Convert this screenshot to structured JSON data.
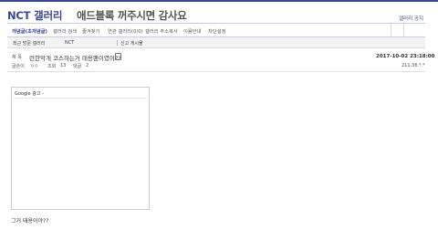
{
  "header": {
    "gallery_name": "NCT 갤러리",
    "subtitle": "애드블록 꺼주시면 감사요",
    "notice_link": "갤러리 공지"
  },
  "menu": {
    "items": [
      {
        "label": "개념글(초개념글)",
        "active": true
      },
      {
        "label": "갤러리 검색"
      },
      {
        "label": "즐겨찾기"
      },
      {
        "label": "연관 갤러리(0/0)"
      },
      {
        "label": "갤러리 주소복사"
      },
      {
        "label": "이용안내"
      },
      {
        "label": "차단설정"
      }
    ]
  },
  "info_bar": {
    "recent_label": "최근 방문 갤러리",
    "recent_gallery": "NCT",
    "new_posts": "신고 게시물"
  },
  "post": {
    "title_label": "제 목",
    "title": "런한악개 코스하는거 태용팬이였어??",
    "date": "2017-10-02 23:18:00",
    "author_label": "글쓴이",
    "author": "ㅇㅇ",
    "views_label": "조회",
    "views": "13",
    "comments_label": "댓글",
    "comments": "2",
    "ip": "211.36.*.*",
    "body": "그거 태용이야??"
  },
  "ad": {
    "label": "Google 광고 -"
  }
}
